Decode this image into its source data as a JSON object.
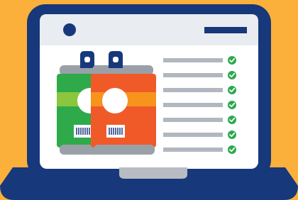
{
  "colors": {
    "background": "#fbb03b",
    "laptop_frame": "#17387a",
    "screen": "#ffffff",
    "topbar": "#e9ecf1",
    "trackpad": "#b8bcc2",
    "line": "#b1b6bf",
    "check": "#2fa84f",
    "can_green": "#2eaa4b",
    "can_orange": "#f05a28",
    "can_stripe": "#8cc63f",
    "can_stripe_orange": "#f7941d",
    "can_metal": "#9aa0a8"
  },
  "icons": {
    "camera": "webcam-dot-icon",
    "menu": "menu-bar-icon",
    "check": "checkmark-circle-icon",
    "barcode": "barcode-icon",
    "pull_tab": "can-pull-tab-icon"
  },
  "checklist": {
    "items": [
      {
        "checked": true
      },
      {
        "checked": true
      },
      {
        "checked": true
      },
      {
        "checked": true
      },
      {
        "checked": true
      },
      {
        "checked": true
      },
      {
        "checked": true
      }
    ]
  },
  "cans": [
    {
      "name": "green-can",
      "color": "#2eaa4b"
    },
    {
      "name": "orange-can",
      "color": "#f05a28"
    }
  ]
}
